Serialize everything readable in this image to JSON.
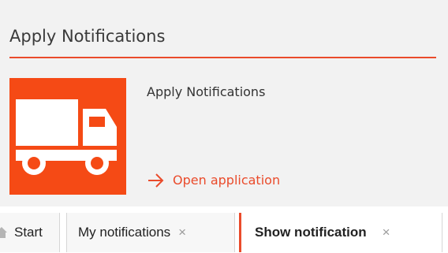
{
  "card": {
    "title": "Apply Notifications",
    "app_name": "Apply Notifications",
    "open_link": "Open application",
    "tile_icon": "truck-icon",
    "accent_color": "#f54a15"
  },
  "tabs": [
    {
      "label": "Start",
      "icon": "home-icon"
    },
    {
      "label": "My notifications",
      "close": "×"
    },
    {
      "label": "Show notification",
      "close": "×",
      "active": true
    }
  ]
}
